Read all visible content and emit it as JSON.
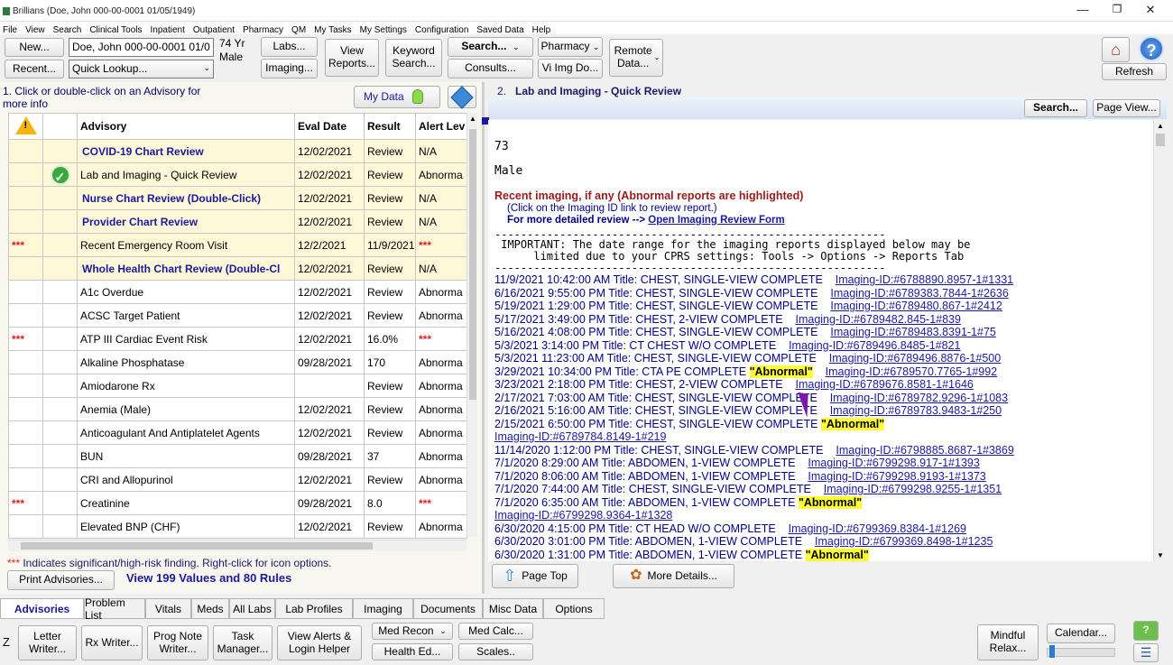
{
  "window": {
    "title": "Brillians (Doe, John  000-00-0001  01/05/1949)"
  },
  "menu": [
    "File",
    "View",
    "Search",
    "Clinical Tools",
    "Inpatient",
    "Outpatient",
    "Pharmacy",
    "QM",
    "My Tasks",
    "My Settings",
    "Configuration",
    "Saved Data",
    "Help"
  ],
  "toolbar": {
    "new": "New...",
    "recent": "Recent...",
    "patient_field": "Doe, John  000-00-0001  01/0",
    "quick_lookup": "Quick Lookup...",
    "age": "74 Yr",
    "sex": "Male",
    "labs": "Labs...",
    "imaging": "Imaging...",
    "view_reports": "View Reports...",
    "keyword_search": "Keyword Search...",
    "search": "Search...",
    "consults": "Consults...",
    "pharmacy": "Pharmacy",
    "vi_img": "Vi Img Do...",
    "remote_data": "Remote Data...",
    "refresh": "Refresh"
  },
  "left": {
    "header": "1. Click or double-click on an Advisory for more info",
    "my_data": "My Data",
    "columns": [
      "",
      "",
      "Advisory",
      "Eval Date",
      "Result",
      "Alert Lev"
    ],
    "rows": [
      {
        "flag": "",
        "check": false,
        "name": "COVID-19 Chart Review",
        "date": "12/02/2021",
        "result": "Review",
        "alert": "N/A",
        "style": "bold",
        "hl": true
      },
      {
        "flag": "",
        "check": true,
        "name": "Lab and Imaging - Quick Review",
        "date": "12/02/2021",
        "result": "Review",
        "alert": "Abnorma",
        "style": "",
        "hl": true
      },
      {
        "flag": "",
        "check": false,
        "name": "Nurse Chart Review (Double-Click)",
        "date": "12/02/2021",
        "result": "Review",
        "alert": "N/A",
        "style": "bold",
        "hl": true
      },
      {
        "flag": "",
        "check": false,
        "name": "Provider Chart Review",
        "date": "12/02/2021",
        "result": "Review",
        "alert": "N/A",
        "style": "bold",
        "hl": true
      },
      {
        "flag": "***",
        "check": false,
        "name": "Recent Emergency Room Visit",
        "date": "12/2/2021",
        "result": "11/9/2021",
        "alert": "***",
        "style": "",
        "hl": true
      },
      {
        "flag": "",
        "check": false,
        "name": "Whole Health Chart Review (Double-Cl",
        "date": "12/02/2021",
        "result": "Review",
        "alert": "N/A",
        "style": "bold",
        "hl": true
      },
      {
        "flag": "",
        "check": false,
        "name": "A1c Overdue",
        "date": "12/02/2021",
        "result": "Review",
        "alert": "Abnorma",
        "style": "",
        "hl": false
      },
      {
        "flag": "",
        "check": false,
        "name": "ACSC Target Patient",
        "date": "12/02/2021",
        "result": "Review",
        "alert": "Abnorma",
        "style": "",
        "hl": false
      },
      {
        "flag": "***",
        "check": false,
        "name": "ATP III Cardiac Event Risk",
        "date": "12/02/2021",
        "result": "16.0%",
        "alert": "***",
        "style": "",
        "hl": false
      },
      {
        "flag": "",
        "check": false,
        "name": "Alkaline Phosphatase",
        "date": "09/28/2021",
        "result": "170",
        "alert": "Abnorma",
        "style": "",
        "hl": false
      },
      {
        "flag": "",
        "check": false,
        "name": "Amiodarone Rx",
        "date": "",
        "result": "Review",
        "alert": "Abnorma",
        "style": "",
        "hl": false
      },
      {
        "flag": "",
        "check": false,
        "name": "Anemia (Male)",
        "date": "12/02/2021",
        "result": "Review",
        "alert": "Abnorma",
        "style": "",
        "hl": false
      },
      {
        "flag": "",
        "check": false,
        "name": "Anticoagulant And Antiplatelet Agents",
        "date": "12/02/2021",
        "result": "Review",
        "alert": "Abnorma",
        "style": "",
        "hl": false
      },
      {
        "flag": "",
        "check": false,
        "name": "BUN",
        "date": "09/28/2021",
        "result": "37",
        "alert": "Abnorma",
        "style": "",
        "hl": false
      },
      {
        "flag": "",
        "check": false,
        "name": "CRI and Allopurinol",
        "date": "12/02/2021",
        "result": "Review",
        "alert": "Abnorma",
        "style": "",
        "hl": false
      },
      {
        "flag": "***",
        "check": false,
        "name": "Creatinine",
        "date": "09/28/2021",
        "result": "8.0",
        "alert": "***",
        "style": "",
        "hl": false
      },
      {
        "flag": "",
        "check": false,
        "name": "Elevated BNP (CHF)",
        "date": "12/02/2021",
        "result": "Review",
        "alert": "Abnorma",
        "style": "",
        "hl": false
      }
    ],
    "footnote_stars": "***",
    "footnote": " Indicates significant/high-risk finding. Right-click for icon options.",
    "print": "Print Advisories...",
    "values_summary": "View 199 Values and 80 Rules"
  },
  "right": {
    "header_num": "2.",
    "header_title": "Lab and Imaging - Quick Review",
    "search": "Search...",
    "page_view": "Page View...",
    "age": "73",
    "sex": "Male",
    "imaging_heading": "Recent imaging, if any (Abnormal reports are highlighted)",
    "click_note": "(Click on the Imaging ID link to review report.)",
    "detail_prefix": "For more detailed review --> ",
    "detail_link": "Open Imaging Review Form",
    "dashes": "------------------------------------------------------------",
    "important1": " IMPORTANT: The date range for the imaging reports displayed below may be",
    "important2": "      limited due to your CPRS settings: Tools -> Options -> Reports Tab",
    "entries": [
      {
        "text": "11/9/2021 10:42:00 AM  Title:  CHEST, SINGLE-VIEW  COMPLETE",
        "abn": "",
        "link": "Imaging-ID:#6788890.8957-1#1331",
        "wrap": false
      },
      {
        "text": "6/16/2021 9:55:00 PM  Title:  CHEST, SINGLE-VIEW  COMPLETE",
        "abn": "",
        "link": "Imaging-ID:#6789383.7844-1#2636",
        "wrap": false
      },
      {
        "text": "5/19/2021 1:29:00 PM  Title:  CHEST, SINGLE-VIEW  COMPLETE",
        "abn": "",
        "link": "Imaging-ID:#6789480.867-1#2412",
        "wrap": false
      },
      {
        "text": "5/17/2021 3:49:00 PM  Title:  CHEST, 2-VIEW  COMPLETE",
        "abn": "",
        "link": "Imaging-ID:#6789482.845-1#839",
        "wrap": false
      },
      {
        "text": "5/16/2021 4:08:00 PM  Title:  CHEST, SINGLE-VIEW  COMPLETE",
        "abn": "",
        "link": "Imaging-ID:#6789483.8391-1#75",
        "wrap": false
      },
      {
        "text": "5/3/2021 3:14:00 PM  Title:  CT CHEST W/O  COMPLETE",
        "abn": "",
        "link": "Imaging-ID:#6789496.8485-1#821",
        "wrap": false
      },
      {
        "text": "5/3/2021 11:23:00 AM  Title:  CHEST, SINGLE-VIEW  COMPLETE",
        "abn": "",
        "link": "Imaging-ID:#6789496.8876-1#500",
        "wrap": false
      },
      {
        "text": "3/29/2021 10:34:00 PM  Title:  CTA PE  COMPLETE",
        "abn": "\"Abnormal\"",
        "link": "Imaging-ID:#6789570.7765-1#992",
        "wrap": false
      },
      {
        "text": "3/23/2021 2:18:00 PM  Title:  CHEST, 2-VIEW  COMPLETE",
        "abn": "",
        "link": "Imaging-ID:#6789676.8581-1#1646",
        "wrap": false
      },
      {
        "text": "2/17/2021 7:03:00 AM  Title:  CHEST, SINGLE-VIEW  COMPLETE",
        "abn": "",
        "link": "Imaging-ID:#6789782.9296-1#1083",
        "wrap": false
      },
      {
        "text": "2/16/2021 5:16:00 AM  Title:  CHEST, SINGLE-VIEW  COMPLETE",
        "abn": "",
        "link": "Imaging-ID:#6789783.9483-1#250",
        "wrap": false
      },
      {
        "text": "2/15/2021 6:50:00 PM  Title:  CHEST, SINGLE-VIEW  COMPLETE",
        "abn": "\"Abnormal\"",
        "link": "Imaging-ID:#6789784.8149-1#219",
        "wrap": true
      },
      {
        "text": "11/14/2020 1:12:00 PM  Title:  CHEST, SINGLE-VIEW  COMPLETE",
        "abn": "",
        "link": "Imaging-ID:#6798885.8687-1#3869",
        "wrap": false
      },
      {
        "text": "7/1/2020 8:29:00 AM  Title:  ABDOMEN, 1-VIEW  COMPLETE",
        "abn": "",
        "link": "Imaging-ID:#6799298.917-1#1393",
        "wrap": false
      },
      {
        "text": "7/1/2020 8:06:00 AM  Title:  ABDOMEN, 1-VIEW  COMPLETE",
        "abn": "",
        "link": "Imaging-ID:#6799298.9193-1#1373",
        "wrap": false
      },
      {
        "text": "7/1/2020 7:44:00 AM  Title:  CHEST, SINGLE-VIEW  COMPLETE",
        "abn": "",
        "link": "Imaging-ID:#6799298.9255-1#1351",
        "wrap": false
      },
      {
        "text": "7/1/2020 6:35:00 AM  Title:  ABDOMEN, 1-VIEW  COMPLETE",
        "abn": "\"Abnormal\"",
        "link": "Imaging-ID:#6799298.9364-1#1328",
        "wrap": true
      },
      {
        "text": "6/30/2020 4:15:00 PM  Title:  CT HEAD W/O  COMPLETE",
        "abn": "",
        "link": "Imaging-ID:#6799369.8384-1#1269",
        "wrap": false
      },
      {
        "text": "6/30/2020 3:01:00 PM  Title:  ABDOMEN, 1-VIEW  COMPLETE",
        "abn": "",
        "link": "Imaging-ID:#6799369.8498-1#1235",
        "wrap": false
      },
      {
        "text": "6/30/2020 1:31:00 PM  Title:  ABDOMEN, 1-VIEW  COMPLETE",
        "abn": "\"Abnormal\"",
        "link": "",
        "wrap": false
      }
    ],
    "page_top": "Page Top",
    "more_details": "More Details..."
  },
  "tabs": [
    "Advisories",
    "Problem List",
    "Vitals",
    "Meds",
    "All Labs",
    "Lab Profiles",
    "Imaging",
    "Documents",
    "Misc Data",
    "Options"
  ],
  "bottom": {
    "z": "Z",
    "letter": "Letter Writer...",
    "rx": "Rx Writer...",
    "prog_note": "Prog Note Writer...",
    "task": "Task Manager...",
    "alerts": "View Alerts & Login Helper",
    "med_recon": "Med Recon",
    "health_ed": "Health Ed...",
    "med_calc": "Med Calc...",
    "scales": "Scales..",
    "mindful": "Mindful Relax...",
    "calendar": "Calendar..."
  }
}
